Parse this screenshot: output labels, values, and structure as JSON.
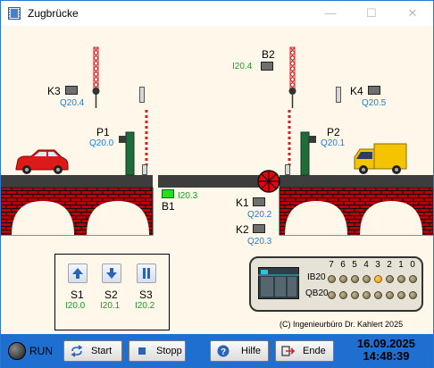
{
  "window": {
    "title": "Zugbrücke",
    "min_glyph": "—",
    "max_glyph": "☐",
    "close_glyph": "✕",
    "icon": "film-app-icon"
  },
  "scene": {
    "sensors": {
      "B1": {
        "label": "B1",
        "address": "I20.3",
        "active": true
      },
      "B2": {
        "label": "B2",
        "address": "I20.4",
        "active": false
      },
      "K1": {
        "label": "K1",
        "address": "Q20.2"
      },
      "K2": {
        "label": "K2",
        "address": "Q20.3"
      },
      "K3": {
        "label": "K3",
        "address": "Q20.4"
      },
      "K4": {
        "label": "K4",
        "address": "Q20.5"
      }
    },
    "signals": {
      "P1": {
        "label": "P1",
        "address": "Q20.0"
      },
      "P2": {
        "label": "P2",
        "address": "Q20.1"
      }
    }
  },
  "controls": {
    "buttons": [
      {
        "label": "S1",
        "address": "I20.0",
        "icon": "arrow-up-icon"
      },
      {
        "label": "S2",
        "address": "I20.1",
        "icon": "arrow-down-icon"
      },
      {
        "label": "S3",
        "address": "I20.2",
        "icon": "pause-icon"
      }
    ]
  },
  "io_panel": {
    "bit_numbers": [
      "7",
      "6",
      "5",
      "4",
      "3",
      "2",
      "1",
      "0"
    ],
    "rows": [
      {
        "label": "IB20",
        "bits": [
          0,
          0,
          0,
          0,
          1,
          0,
          0,
          0
        ]
      },
      {
        "label": "QB20",
        "bits": [
          0,
          0,
          0,
          0,
          0,
          0,
          0,
          0
        ]
      }
    ],
    "colors": {
      "led_on": "#f08c00",
      "led_off": "#8a7d55"
    }
  },
  "copyright": "(C) Ingenieurbüro Dr. Kahlert 2025",
  "toolbar": {
    "run_label": "RUN",
    "start_label": "Start",
    "stop_label": "Stopp",
    "help_label": "Hilfe",
    "exit_label": "Ende"
  },
  "status": {
    "date": "16.09.2025",
    "time": "14:48:39"
  },
  "colors": {
    "accent": "#1f6fd0",
    "brick": "#b8000a",
    "address_blue": "#1a7fd6",
    "address_green": "#1b9a2a"
  }
}
